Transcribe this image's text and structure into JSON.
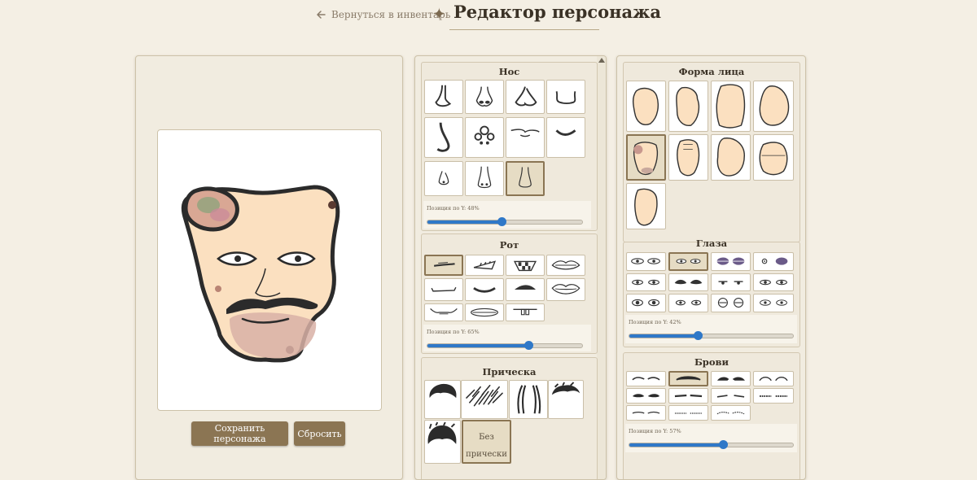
{
  "header": {
    "back_label": "Вернуться в инвентарь",
    "title_glyph": "✦",
    "title": "Редактор персонажа"
  },
  "actions": {
    "save_label": "Сохранить персонажа",
    "reset_label": "Сбросить"
  },
  "sections": {
    "nose": {
      "title": "Нос",
      "slider_label": "Позиция по Y: 48%",
      "slider_value": 0.48,
      "selected_index": 10
    },
    "mouth": {
      "title": "Рот",
      "slider_label": "Позиция по Y: 65%",
      "slider_value": 0.65,
      "selected_index": 0
    },
    "hair": {
      "title": "Прическа",
      "none_label": "Без прически",
      "selected_index": 5
    },
    "face_shape": {
      "title": "Форма лица",
      "selected_index": 4
    },
    "eyes": {
      "title": "Глаза",
      "slider_label": "Позиция по Y: 42%",
      "slider_value": 0.42,
      "selected_index": 1
    },
    "brows": {
      "title": "Брови",
      "slider_label": "Позиция по Y: 57%",
      "slider_value": 0.57,
      "selected_index": 1
    }
  },
  "colors": {
    "accent": "#8b7553",
    "slider": "#2f78c8",
    "skin": "#fbe0c0",
    "panel": "#f1ece0"
  },
  "icons": {
    "back": "arrow-left-icon",
    "title": "sparkle-icon"
  }
}
